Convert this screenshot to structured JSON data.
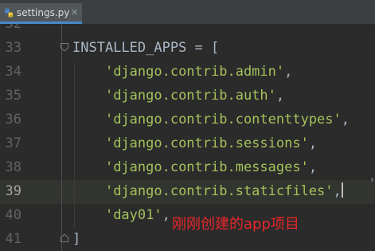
{
  "tab": {
    "filename": "settings.py",
    "close_glyph": "✕",
    "icon": "python-file-icon"
  },
  "editor": {
    "lines": [
      {
        "number": "32",
        "tokens": []
      },
      {
        "number": "33",
        "tokens": [
          {
            "t": "INSTALLED_APPS = [",
            "k": "plain"
          }
        ],
        "fold": "open"
      },
      {
        "number": "34",
        "tokens": [
          {
            "t": "'django.contrib.admin'",
            "k": "str"
          },
          {
            "t": ",",
            "k": "plain"
          }
        ]
      },
      {
        "number": "35",
        "tokens": [
          {
            "t": "'django.contrib.auth'",
            "k": "str"
          },
          {
            "t": ",",
            "k": "plain"
          }
        ]
      },
      {
        "number": "36",
        "tokens": [
          {
            "t": "'django.contrib.contenttypes'",
            "k": "str"
          },
          {
            "t": ",",
            "k": "plain"
          }
        ]
      },
      {
        "number": "37",
        "tokens": [
          {
            "t": "'django.contrib.sessions'",
            "k": "str"
          },
          {
            "t": ",",
            "k": "plain"
          }
        ]
      },
      {
        "number": "38",
        "tokens": [
          {
            "t": "'django.contrib.messages'",
            "k": "str"
          },
          {
            "t": ",",
            "k": "plain"
          }
        ]
      },
      {
        "number": "39",
        "tokens": [
          {
            "t": "'django.contrib.staticfiles'",
            "k": "str"
          },
          {
            "t": ",",
            "k": "plain"
          }
        ],
        "active": true
      },
      {
        "number": "40",
        "tokens": [
          {
            "t": "'day01'",
            "k": "str"
          },
          {
            "t": ",",
            "k": "plain"
          }
        ]
      },
      {
        "number": "41",
        "tokens": [
          {
            "t": "]",
            "k": "plain"
          }
        ],
        "fold": "close"
      }
    ],
    "active_line": "39"
  },
  "annotation": {
    "text": "刚刚创建的app项目",
    "color": "#e8262b"
  },
  "colors": {
    "background": "#2b2b2b",
    "string": "#a5c25c",
    "plain": "#a9b7c6",
    "line_number": "#606366",
    "tab_accent": "#4a88c7"
  }
}
